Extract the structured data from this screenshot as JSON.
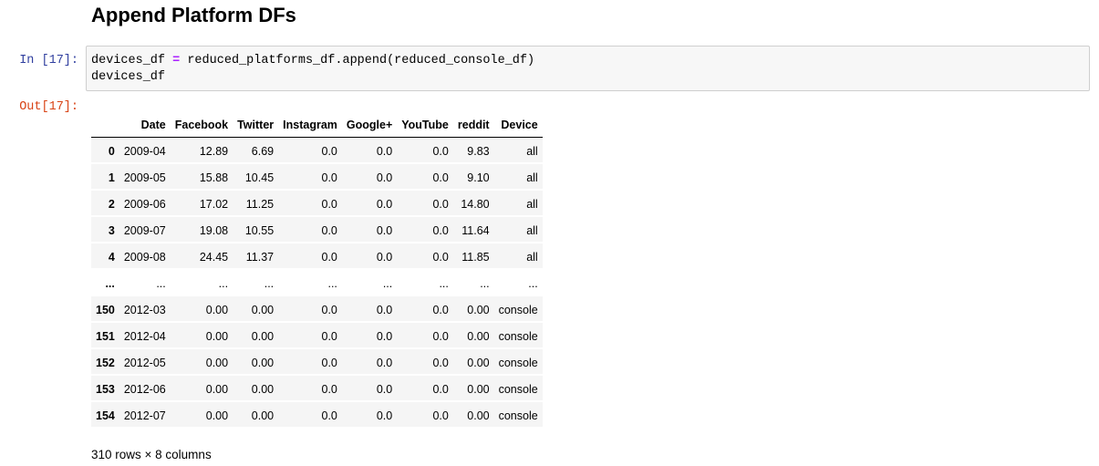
{
  "heading": "Append Platform DFs",
  "cell": {
    "in_prompt": "In [17]:",
    "out_prompt": "Out[17]:",
    "code_line1_a": "devices_df ",
    "code_line1_op": "=",
    "code_line1_b": " reduced_platforms_df.append(reduced_console_df)",
    "code_line2": "devices_df"
  },
  "table": {
    "columns": [
      "",
      "Date",
      "Facebook",
      "Twitter",
      "Instagram",
      "Google+",
      "YouTube",
      "reddit",
      "Device"
    ],
    "rows": [
      [
        "0",
        "2009-04",
        "12.89",
        "6.69",
        "0.0",
        "0.0",
        "0.0",
        "9.83",
        "all"
      ],
      [
        "1",
        "2009-05",
        "15.88",
        "10.45",
        "0.0",
        "0.0",
        "0.0",
        "9.10",
        "all"
      ],
      [
        "2",
        "2009-06",
        "17.02",
        "11.25",
        "0.0",
        "0.0",
        "0.0",
        "14.80",
        "all"
      ],
      [
        "3",
        "2009-07",
        "19.08",
        "10.55",
        "0.0",
        "0.0",
        "0.0",
        "11.64",
        "all"
      ],
      [
        "4",
        "2009-08",
        "24.45",
        "11.37",
        "0.0",
        "0.0",
        "0.0",
        "11.85",
        "all"
      ],
      [
        "...",
        "...",
        "...",
        "...",
        "...",
        "...",
        "...",
        "...",
        "..."
      ],
      [
        "150",
        "2012-03",
        "0.00",
        "0.00",
        "0.0",
        "0.0",
        "0.0",
        "0.00",
        "console"
      ],
      [
        "151",
        "2012-04",
        "0.00",
        "0.00",
        "0.0",
        "0.0",
        "0.0",
        "0.00",
        "console"
      ],
      [
        "152",
        "2012-05",
        "0.00",
        "0.00",
        "0.0",
        "0.0",
        "0.0",
        "0.00",
        "console"
      ],
      [
        "153",
        "2012-06",
        "0.00",
        "0.00",
        "0.0",
        "0.0",
        "0.0",
        "0.00",
        "console"
      ],
      [
        "154",
        "2012-07",
        "0.00",
        "0.00",
        "0.0",
        "0.0",
        "0.0",
        "0.00",
        "console"
      ]
    ]
  },
  "shape": "310 rows × 8 columns"
}
